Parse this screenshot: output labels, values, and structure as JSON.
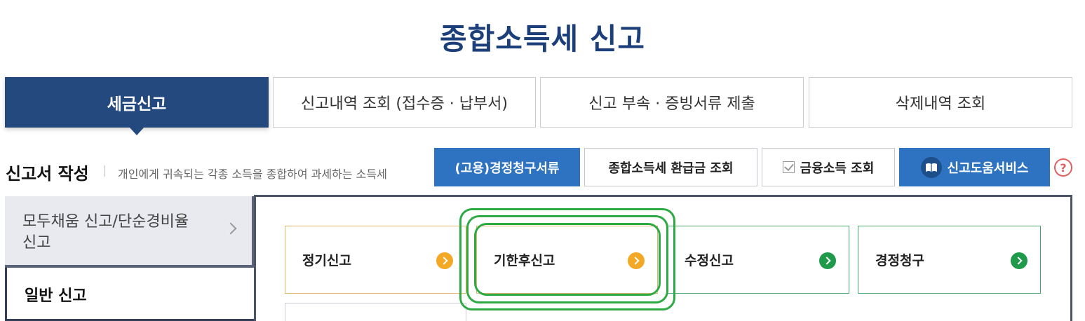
{
  "title": "종합소득세 신고",
  "tabs": [
    {
      "label": "세금신고",
      "active": true
    },
    {
      "label": "신고내역 조회 (접수증 · 납부서)",
      "active": false
    },
    {
      "label": "신고 부속 · 증빙서류 제출",
      "active": false
    },
    {
      "label": "삭제내역 조회",
      "active": false
    }
  ],
  "section": {
    "title": "신고서 작성",
    "description": "개인에게 귀속되는 각종 소득을 종합하여 과세하는 소득세"
  },
  "tool_buttons": {
    "employment": "(고용)경정청구서류",
    "refund": "종합소득세 환급금 조회",
    "financial": "금융소득 조회",
    "help_service": "신고도움서비스",
    "help_icon": "?"
  },
  "side_menu": [
    {
      "label": "모두채움 신고/단순경비율 신고"
    },
    {
      "label": "일반 신고"
    }
  ],
  "filing_cards": [
    {
      "label": "정기신고",
      "icon_color": "#f3a826"
    },
    {
      "label": "기한후신고",
      "icon_color": "#f3a826"
    },
    {
      "label": "수정신고",
      "icon_color": "#1f9a4a"
    },
    {
      "label": "경정청구",
      "icon_color": "#1f9a4a"
    }
  ],
  "colors": {
    "primary_navy": "#24497f",
    "button_blue": "#2e73c1",
    "highlight_green": "#2eaa45"
  }
}
